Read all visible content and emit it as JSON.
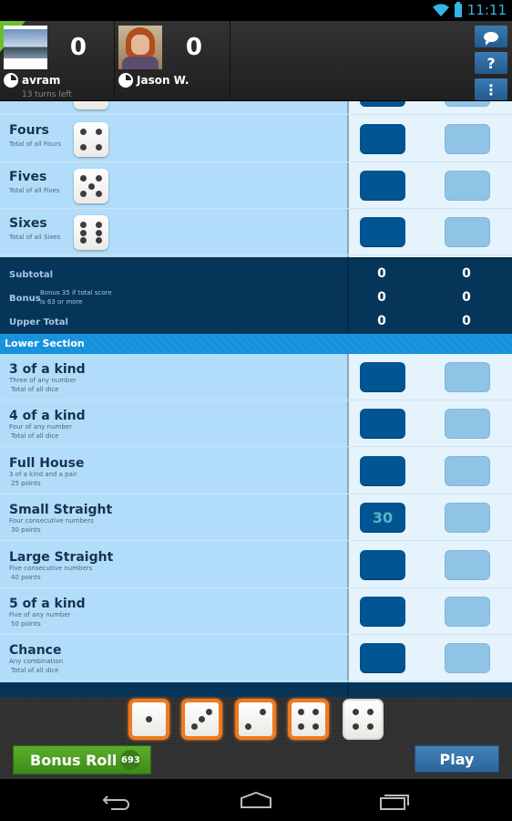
{
  "status_bar": {
    "time": "11:11",
    "icons": [
      "wifi-icon",
      "battery-charging-icon"
    ]
  },
  "players": [
    {
      "name": "avram",
      "score": "0",
      "turns_left": "13 turns left",
      "active": true,
      "avatar": "landscape-photo"
    },
    {
      "name": "Jason W.",
      "score": "0",
      "avatar": "child-portrait-photo"
    }
  ],
  "header_buttons": [
    {
      "name": "chat",
      "icon": "chat-bubble-icon"
    },
    {
      "name": "help",
      "label": "?",
      "icon": "help-icon"
    },
    {
      "name": "menu",
      "label": "⋮",
      "icon": "overflow-menu-icon"
    }
  ],
  "upper_rows": [
    {
      "title": "Fours",
      "desc": "Total of all Fours",
      "die": 4,
      "my_score": "",
      "their_score": ""
    },
    {
      "title": "Fives",
      "desc": "Total of all Fives",
      "die": 5,
      "my_score": "",
      "their_score": ""
    },
    {
      "title": "Sixes",
      "desc": "Total of all Sixes",
      "die": 6,
      "my_score": "",
      "their_score": ""
    }
  ],
  "upper_totals": {
    "subtotal": {
      "label": "Subtotal",
      "values": [
        "0",
        "0"
      ]
    },
    "bonus": {
      "label": "Bonus",
      "note": "Bonus 35 if total score is 63 or more",
      "values": [
        "0",
        "0"
      ]
    },
    "upper_total": {
      "label": "Upper Total",
      "values": [
        "0",
        "0"
      ]
    }
  },
  "lower_section_label": "Lower Section",
  "lower_rows": [
    {
      "title": "3 of a kind",
      "desc": "Three of any number",
      "points": "Total of all dice",
      "my_score": "",
      "their_score": ""
    },
    {
      "title": "4 of a kind",
      "desc": "Four of any number",
      "points": "Total of all dice",
      "my_score": "",
      "their_score": ""
    },
    {
      "title": "Full House",
      "desc": "3 of a kind and a pair",
      "points": "25 points",
      "my_score": "",
      "their_score": ""
    },
    {
      "title": "Small Straight",
      "desc": "Four consecutive numbers",
      "points": "30 points",
      "my_score": "30",
      "their_score": ""
    },
    {
      "title": "Large Straight",
      "desc": "Five consecutive numbers",
      "points": "40 points",
      "my_score": "",
      "their_score": ""
    },
    {
      "title": "5 of a kind",
      "desc": "Five of any number",
      "points": "50 points",
      "my_score": "",
      "their_score": ""
    },
    {
      "title": "Chance",
      "desc": "Any combination",
      "points": "Total of all dice",
      "my_score": "",
      "their_score": ""
    }
  ],
  "dice": [
    {
      "value": 1,
      "held": true
    },
    {
      "value": 3,
      "held": true
    },
    {
      "value": 2,
      "held": true
    },
    {
      "value": 4,
      "held": true
    },
    {
      "value": 4,
      "held": false
    }
  ],
  "actions": {
    "bonus_roll_label": "Bonus Roll",
    "bonus_roll_count": "693",
    "play_label": "Play"
  },
  "colors": {
    "held_die_border": "#f07a1e",
    "my_cell": "#005592",
    "their_cell": "#8fc4e6",
    "bonus_button": "#4c9c21",
    "play_button": "#3574aa",
    "lower_header": "#1790dc"
  },
  "nav_bar": [
    "back-icon",
    "home-icon",
    "recent-apps-icon"
  ]
}
